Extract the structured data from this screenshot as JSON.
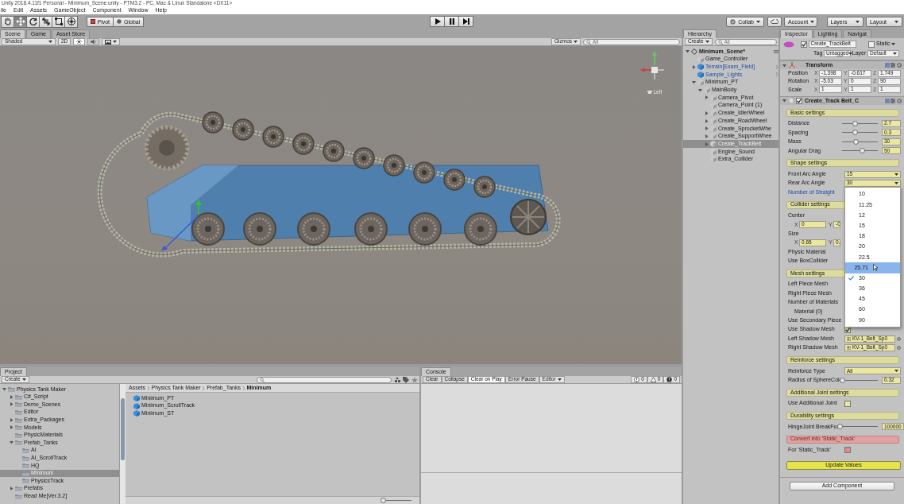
{
  "window": {
    "title": "Unity 2018.4.11f1 Personal - Minimum_Scene.unity - PTM3.2 - PC, Mac & Linux Standalone <DX11>"
  },
  "menu": [
    "ile",
    "Edit",
    "Assets",
    "GameObject",
    "Component",
    "Window",
    "Help"
  ],
  "toolbar": {
    "tools": [
      {
        "kind": "hand",
        "selected": false
      },
      {
        "kind": "move",
        "selected": true
      },
      {
        "kind": "rotate",
        "selected": false
      },
      {
        "kind": "scale",
        "selected": false
      },
      {
        "kind": "rect",
        "selected": false
      },
      {
        "kind": "transform",
        "selected": false
      }
    ],
    "pivot": "Pivot",
    "global": "Global",
    "playback": [
      {
        "kind": "play"
      },
      {
        "kind": "pause"
      },
      {
        "kind": "step"
      }
    ],
    "collab": "Collab",
    "account": "Account",
    "layers": "Layers",
    "layout": "Layout"
  },
  "scene": {
    "tabs": [
      {
        "label": "Scene",
        "selected": true
      },
      {
        "label": "Game",
        "selected": false
      },
      {
        "label": "Asset Store",
        "selected": false
      }
    ],
    "shading": "Shaded",
    "mode_2d": "2D",
    "toggles": [
      {
        "kind": "lighting",
        "on": true
      },
      {
        "kind": "audio",
        "on": false
      }
    ],
    "gizmos": "Gizmos",
    "search": {
      "placeholder": "All"
    },
    "view_label": "Left"
  },
  "hierarchy": {
    "tab": "Hierarchy",
    "create": "Create",
    "search": {
      "placeholder": "All"
    },
    "scene": "Minimum_Scene*",
    "items": [
      {
        "label": "Game_Controller",
        "kind": "object",
        "expandable": false,
        "selected": false
      },
      {
        "label": "Terrain[Exam_Field]",
        "kind": "prefab",
        "expandable": true,
        "expanded": false,
        "selected": false
      },
      {
        "label": "Sample_Lights",
        "kind": "prefab",
        "expandable": false,
        "selected": false
      },
      {
        "label": "Minimum_PT",
        "kind": "object",
        "expandable": true,
        "expanded": true,
        "selected": false,
        "children": [
          {
            "label": "MainBody",
            "kind": "object",
            "expandable": true,
            "expanded": true,
            "selected": false,
            "children": [
              {
                "label": "Camera_Pivot",
                "kind": "object",
                "expandable": true,
                "expanded": false,
                "selected": false
              },
              {
                "label": "Camera_Point (1)",
                "kind": "object",
                "expandable": false,
                "selected": false
              },
              {
                "label": "Create_IdlerWheel",
                "kind": "object",
                "expandable": true,
                "expanded": false,
                "selected": false
              },
              {
                "label": "Create_RoadWheel",
                "kind": "object",
                "expandable": true,
                "expanded": false,
                "selected": false
              },
              {
                "label": "Create_SprocketWhe",
                "kind": "object",
                "expandable": true,
                "expanded": false,
                "selected": false
              },
              {
                "label": "Create_SupportWhee",
                "kind": "object",
                "expandable": true,
                "expanded": false,
                "selected": false
              },
              {
                "label": "Create_TrackBelt",
                "kind": "object",
                "expandable": true,
                "expanded": false,
                "selected": true
              },
              {
                "label": "Engine_Sound",
                "kind": "object",
                "expandable": false,
                "selected": false
              },
              {
                "label": "Extra_Collider",
                "kind": "object",
                "expandable": false,
                "selected": false
              }
            ]
          }
        ]
      }
    ]
  },
  "inspector": {
    "tabs": [
      {
        "label": "Inspector",
        "selected": true
      },
      {
        "label": "Lighting",
        "selected": false
      },
      {
        "label": "Navigat",
        "selected": false
      }
    ],
    "object": {
      "active": true,
      "name": "Create_TrackBelt",
      "static_label": "Static",
      "static": false,
      "tag_label": "Tag",
      "tag": "Untagged",
      "layer_label": "Layer",
      "layer": "Default"
    },
    "transform": {
      "title": "Transform",
      "rows": [
        {
          "label": "Position",
          "values": [
            {
              "axis": "X",
              "value": "-1.398"
            },
            {
              "axis": "Y",
              "value": "-0.617"
            },
            {
              "axis": "Z",
              "value": "1.749"
            }
          ]
        },
        {
          "label": "Rotation",
          "values": [
            {
              "axis": "X",
              "value": "-5.03"
            },
            {
              "axis": "Y",
              "value": "0"
            },
            {
              "axis": "Z",
              "value": "90"
            }
          ]
        },
        {
          "label": "Scale",
          "values": [
            {
              "axis": "X",
              "value": "1"
            },
            {
              "axis": "Y",
              "value": "1"
            },
            {
              "axis": "Z",
              "value": "1"
            }
          ]
        }
      ]
    },
    "component": {
      "title": "Create_Track Belt_C",
      "enabled": true
    },
    "rows": [
      {
        "kind": "section",
        "label": "Basic settings"
      },
      {
        "kind": "slider",
        "label": "Distance",
        "level": 0.35,
        "value": "2.7",
        "overridden": false
      },
      {
        "kind": "slider",
        "label": "Spacing",
        "level": 0.35,
        "value": "0.3",
        "overridden": false
      },
      {
        "kind": "slider",
        "label": "Mass",
        "level": 0.38,
        "value": "30",
        "overridden": false
      },
      {
        "kind": "slider",
        "label": "Angular Drag",
        "level": 0.55,
        "value": "50",
        "overridden": false
      },
      {
        "kind": "section",
        "label": "Shape settings"
      },
      {
        "kind": "dropdown",
        "label": "Front Arc Angle",
        "value": "15",
        "overridden": false
      },
      {
        "kind": "dropdown",
        "label": "Rear Arc Angle",
        "value": "30",
        "overridden": false
      },
      {
        "kind": "label",
        "label": "Number of Straight",
        "overridden": true
      },
      {
        "kind": "section",
        "label": "Collider settings"
      },
      {
        "kind": "label",
        "label": "Center",
        "overridden": false
      },
      {
        "kind": "vector",
        "values": [
          {
            "axis": "X",
            "value": "0"
          },
          {
            "axis": "Y",
            "value": "-0"
          }
        ]
      },
      {
        "kind": "label",
        "label": "Size",
        "overridden": false
      },
      {
        "kind": "vector",
        "values": [
          {
            "axis": "X",
            "value": "0.65"
          },
          {
            "axis": "Y",
            "value": "0."
          }
        ]
      },
      {
        "kind": "label",
        "label": "Physic Material",
        "overridden": false
      },
      {
        "kind": "label",
        "label": "Use BoxCollider",
        "overridden": false
      },
      {
        "kind": "section",
        "label": "Mesh settings"
      },
      {
        "kind": "label",
        "label": "Left Piece Mesh",
        "overridden": false
      },
      {
        "kind": "label",
        "label": "Right Piece Mesh",
        "overridden": false
      },
      {
        "kind": "label",
        "label": "Number of Materials",
        "overridden": false,
        "children": [
          {
            "kind": "label",
            "label": "Material (0)",
            "overridden": false
          }
        ]
      },
      {
        "kind": "label",
        "label": "Use Secondary Piece",
        "overridden": false
      },
      {
        "kind": "checkbox",
        "label": "Use Shadow Mesh",
        "checked": true,
        "overridden": false
      },
      {
        "kind": "object",
        "label": "Left Shadow Mesh",
        "value": "KV-1_Belt_Sp0",
        "overridden": false
      },
      {
        "kind": "object",
        "label": "Right Shadow Mesh",
        "value": "KV-1_Belt_Sp0",
        "overridden": false
      },
      {
        "kind": "section",
        "label": "Reinforce settings"
      },
      {
        "kind": "dropdown",
        "label": "Reinforce Type",
        "value": "All",
        "overridden": false
      },
      {
        "kind": "slider",
        "label": "Radius of SphereCol",
        "level": 0.12,
        "value": "0.32",
        "overridden": false
      },
      {
        "kind": "section",
        "label": "Additional Joint settings"
      },
      {
        "kind": "checkbox",
        "label": "Use Additional Joint",
        "checked": false,
        "overridden": false
      },
      {
        "kind": "section",
        "label": "Durability settings"
      },
      {
        "kind": "slider",
        "label": "HingeJoint BreakFor",
        "level": 0.05,
        "value": "100000",
        "overridden": false
      },
      {
        "kind": "alert_section",
        "label": "Convert into 'Static_Track'"
      },
      {
        "kind": "alert_checkbox",
        "label": "For 'Static_Track'",
        "checked": false,
        "overridden": false
      },
      {
        "kind": "button",
        "label": "Update Values"
      }
    ],
    "popup": {
      "options": [
        {
          "label": "10",
          "selected": false,
          "hovered": false
        },
        {
          "label": "11.25",
          "selected": false,
          "hovered": false
        },
        {
          "label": "12",
          "selected": false,
          "hovered": false
        },
        {
          "label": "15",
          "selected": false,
          "hovered": false
        },
        {
          "label": "18",
          "selected": false,
          "hovered": false
        },
        {
          "label": "20",
          "selected": false,
          "hovered": false
        },
        {
          "label": "22.5",
          "selected": false,
          "hovered": false
        },
        {
          "label": "25.71",
          "selected": false,
          "hovered": true
        },
        {
          "label": "30",
          "selected": true,
          "hovered": false
        },
        {
          "label": "36",
          "selected": false,
          "hovered": false
        },
        {
          "label": "45",
          "selected": false,
          "hovered": false
        },
        {
          "label": "60",
          "selected": false,
          "hovered": false
        },
        {
          "label": "90",
          "selected": false,
          "hovered": false
        }
      ]
    },
    "add_component": "Add Component"
  },
  "project": {
    "tab": "Project",
    "create": "Create",
    "breadcrumb": [
      "Assets",
      "Physics Tank Maker",
      "Prefab_Tanks",
      "Minimum"
    ],
    "tree": [
      {
        "label": "Physics Tank Maker",
        "expandable": true,
        "expanded": true,
        "selected": false,
        "children": [
          {
            "label": "C#_Script",
            "expandable": true,
            "expanded": false,
            "selected": false
          },
          {
            "label": "Demo_Scenes",
            "expandable": true,
            "expanded": false,
            "selected": false
          },
          {
            "label": "Editor",
            "expandable": false,
            "selected": false
          },
          {
            "label": "Extra_Packages",
            "expandable": true,
            "expanded": false,
            "selected": false
          },
          {
            "label": "Models",
            "expandable": true,
            "expanded": false,
            "selected": false
          },
          {
            "label": "PhysicMaterials",
            "expandable": false,
            "selected": false
          },
          {
            "label": "Prefab_Tanks",
            "expandable": true,
            "expanded": true,
            "selected": false,
            "children": [
              {
                "label": "AI",
                "expandable": false,
                "selected": false
              },
              {
                "label": "AI_ScrollTrack",
                "expandable": false,
                "selected": false
              },
              {
                "label": "HQ",
                "expandable": false,
                "selected": false
              },
              {
                "label": "Minimum",
                "expandable": false,
                "selected": true
              },
              {
                "label": "PhysicsTrack",
                "expandable": false,
                "selected": false
              }
            ]
          },
          {
            "label": "Prefabs",
            "expandable": true,
            "expanded": false,
            "selected": false
          },
          {
            "label": "Read Me[Ver.3.2]",
            "expandable": false,
            "selected": false
          }
        ]
      }
    ],
    "files": [
      "Minimum_PT",
      "Minimum_ScrollTrack",
      "Minimum_ST"
    ],
    "size_slider": {
      "level": 0.05
    }
  },
  "console": {
    "tab": "Console",
    "buttons": [
      {
        "label": "Clear",
        "selected": false
      },
      {
        "label": "Collapse",
        "selected": false
      },
      {
        "label": "Clear on Play",
        "selected": true
      },
      {
        "label": "Error Pause",
        "selected": false
      }
    ],
    "source": "Editor",
    "counts": [
      {
        "kind": "info",
        "count": "0"
      },
      {
        "kind": "warning",
        "count": "0"
      },
      {
        "kind": "error",
        "count": "0"
      }
    ]
  }
}
